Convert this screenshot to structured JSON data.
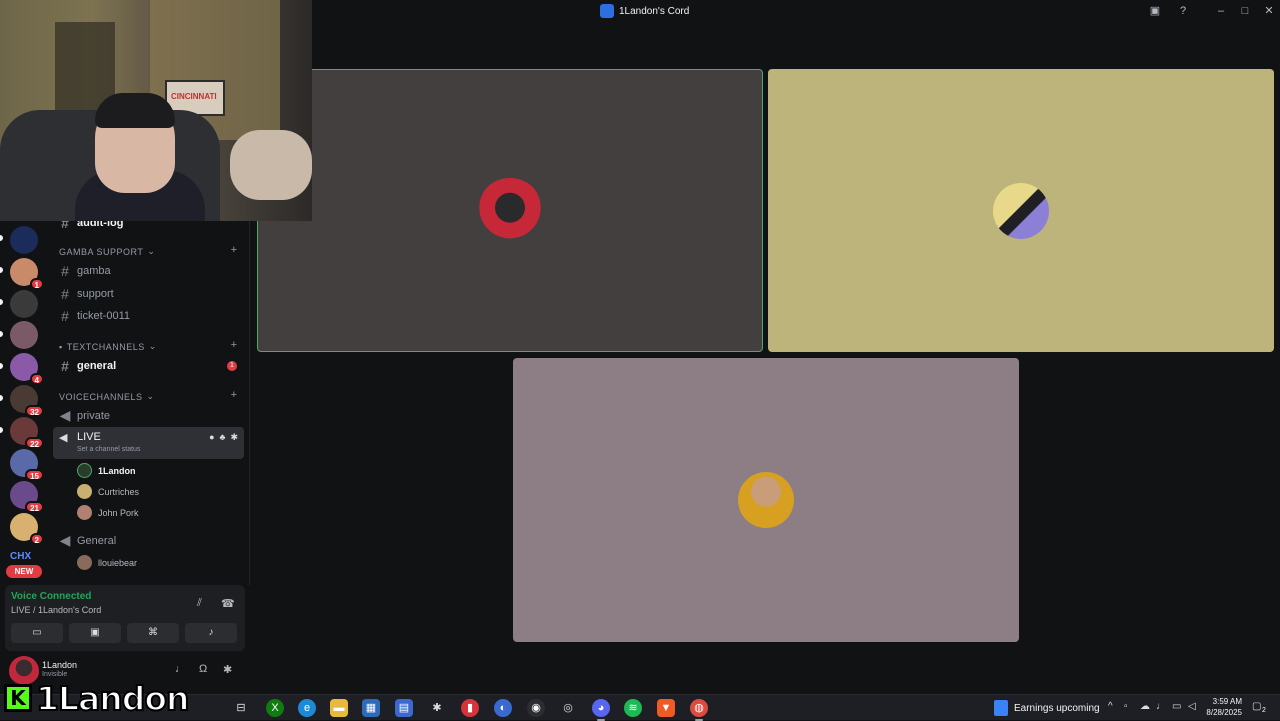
{
  "window": {
    "title": "1Landon's Cord"
  },
  "rail": {
    "badges": [
      "1",
      "4",
      "32",
      "22",
      "15",
      "21",
      "2"
    ],
    "text_server": "CHX",
    "new_label": "NEW"
  },
  "channels": {
    "cut_channel": "audit-log",
    "categories": [
      {
        "label": "GAMBA SUPPORT",
        "items": [
          "gamba",
          "support",
          "ticket-0011"
        ]
      },
      {
        "label": "TEXTCHANNELS",
        "items": [
          "general"
        ]
      },
      {
        "label": "VOICECHANNELS",
        "items": [
          "private",
          "LIVE",
          "General"
        ]
      }
    ],
    "general_unread": "1",
    "live": {
      "name": "LIVE",
      "status": "Set a channel status",
      "members": [
        "1Landon",
        "Curtriches",
        "John Pork"
      ]
    },
    "general_voice_members": [
      "llouiebear"
    ]
  },
  "voice": {
    "status": "Voice Connected",
    "location": "LIVE / 1Landon's Cord"
  },
  "user": {
    "name": "1Landon",
    "status": "Invisible"
  },
  "watermark": {
    "letter": "K",
    "text": "1Landon"
  },
  "webcam": {
    "banner_text": "CINCINNATI"
  },
  "taskbar": {
    "news": "Earnings upcoming",
    "time": "3:59 AM",
    "date": "8/28/2025",
    "notifications": "2"
  },
  "colors": {
    "voice_green": "#23a55a",
    "badge_red": "#e23c43",
    "speaking_border": "#4aa96c",
    "tile1_bg": "#433f3f",
    "tile2_bg": "#bdb47c",
    "tile3_bg": "#8d7d84"
  }
}
